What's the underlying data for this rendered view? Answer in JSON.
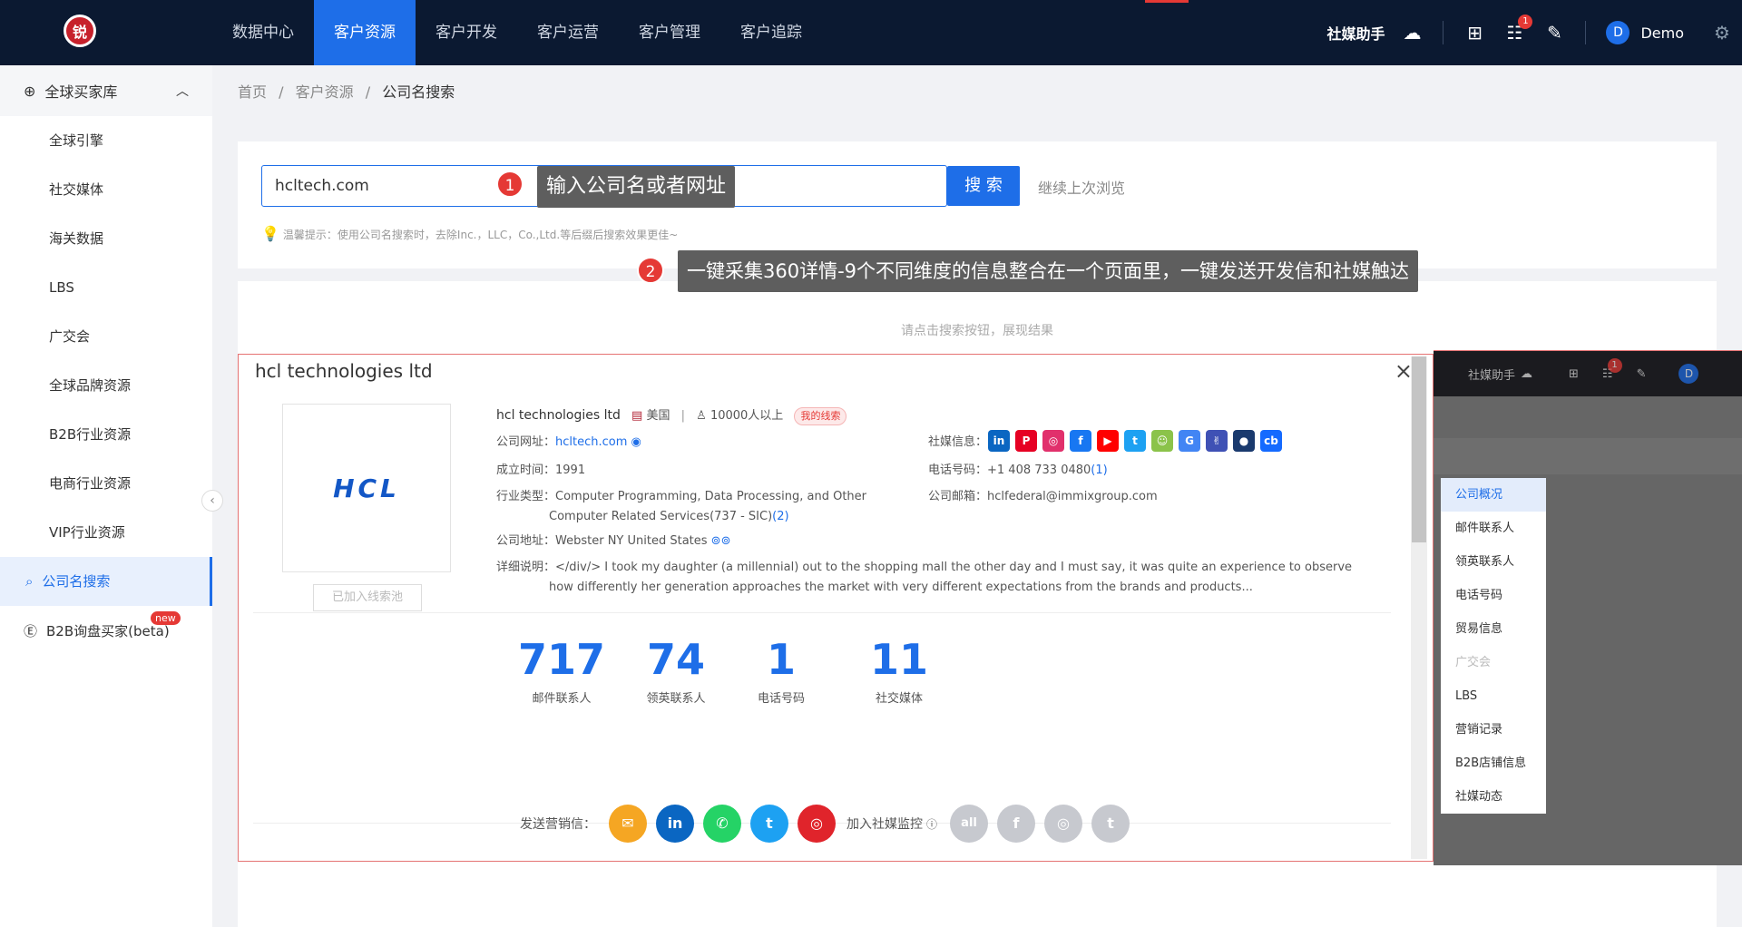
{
  "topbar": {
    "logo_text": "锐",
    "nav": [
      "数据中心",
      "客户资源",
      "客户开发",
      "客户运营",
      "客户管理",
      "客户追踪"
    ],
    "active_index": 1,
    "assistant_label": "社媒助手",
    "badge_count": "1",
    "avatar_letter": "D",
    "user_name": "Demo"
  },
  "sidebar": {
    "group_label": "全球买家库",
    "items": [
      "全球引擎",
      "社交媒体",
      "海关数据",
      "LBS",
      "广交会",
      "全球品牌资源",
      "B2B行业资源",
      "电商行业资源",
      "VIP行业资源"
    ],
    "active_label": "公司名搜索",
    "extra_label": "B2B询盘买家(beta)",
    "new_tag": "new"
  },
  "breadcrumb": {
    "home": "首页",
    "section": "客户资源",
    "current": "公司名搜索",
    "sep": "/"
  },
  "search": {
    "value": "hcltech.com",
    "button": "搜 索",
    "continue": "继续上次浏览",
    "hint": "温馨提示：使用公司名搜索时，去除Inc.，LLC，Co.,Ltd.等后缀后搜索效果更佳~"
  },
  "tips": {
    "tip1_num": "1",
    "tip1": "输入公司名或者网址",
    "tip2_num": "2",
    "tip2": "一键采集360详情-9个不同维度的信息整合在一个页面里，一键发送开发信和社媒触达"
  },
  "result": {
    "empty_hint": "请点击搜索按钮，展现结果"
  },
  "modal": {
    "title": "hcl technologies ltd",
    "close": "×",
    "logo_text": "HCL",
    "add_button": "已加入线索池",
    "company_name": "hcl technologies ltd",
    "country": "美国",
    "employees": "10000人以上",
    "mine_tag": "我的线索",
    "website_label": "公司网址：",
    "website": "hcltech.com",
    "founded_label": "成立时间：",
    "founded": "1991",
    "industry_label": "行业类型：",
    "industry_line1": "Computer Programming, Data Processing, and Other",
    "industry_line2": "Computer Related Services(737 - SIC)",
    "industry_count": "(2)",
    "address_label": "公司地址：",
    "address": "Webster NY United States",
    "detail_label": "详细说明：",
    "detail_line1": "</div/> I took my daughter (a millennial) out to the shopping mall the other day and I must say, it was quite an experience to observe",
    "detail_line2": "how differently her generation approaches the market with very different expectations from the brands and products...",
    "social_label": "社媒信息：",
    "social": [
      {
        "name": "linkedin-icon",
        "glyph": "in",
        "color": "#0a66c2"
      },
      {
        "name": "pinterest-icon",
        "glyph": "P",
        "color": "#e60023"
      },
      {
        "name": "instagram-icon",
        "glyph": "◎",
        "color": "#e1306c"
      },
      {
        "name": "facebook-icon",
        "glyph": "f",
        "color": "#1877f2"
      },
      {
        "name": "youtube-icon",
        "glyph": "▶",
        "color": "#ff0000"
      },
      {
        "name": "twitter-icon",
        "glyph": "t",
        "color": "#1da1f2"
      },
      {
        "name": "bot-icon",
        "glyph": "☺",
        "color": "#8bc34a"
      },
      {
        "name": "google-icon",
        "glyph": "G",
        "color": "#4285f4"
      },
      {
        "name": "peace-icon",
        "glyph": "✌",
        "color": "#3f51b5"
      },
      {
        "name": "map-pin-icon",
        "glyph": "●",
        "color": "#1a3a6e"
      },
      {
        "name": "crunchbase-icon",
        "glyph": "cb",
        "color": "#146aff"
      }
    ],
    "phone_label": "电话号码：",
    "phone": "+1 408 733 0480",
    "phone_count": "(1)",
    "email_label": "公司邮箱：",
    "email": "hclfederal@immixgroup.com",
    "stats": [
      {
        "value": "717",
        "label": "邮件联系人"
      },
      {
        "value": "74",
        "label": "领英联系人"
      },
      {
        "value": "1",
        "label": "电话号码"
      },
      {
        "value": "11",
        "label": "社交媒体"
      }
    ],
    "send_label": "发送营销信：",
    "monitor_label": "加入社媒监控",
    "monitor_all": "all"
  },
  "overlay": {
    "assistant_label": "社媒助手",
    "badge": "1",
    "avatar": "D",
    "menu": [
      "公司概况",
      "邮件联系人",
      "领英联系人",
      "电话号码",
      "贸易信息",
      "广交会",
      "LBS",
      "营销记录",
      "B2B店铺信息",
      "社媒动态"
    ]
  }
}
